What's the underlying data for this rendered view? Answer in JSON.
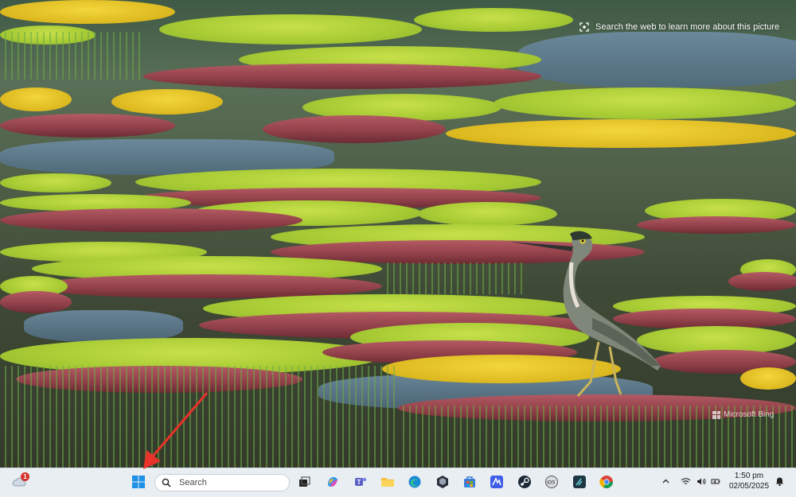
{
  "desktop": {
    "lens_hint": "Search the web to learn more about this picture",
    "watermark": "Microsoft Bing"
  },
  "taskbar": {
    "weather_badge": "1",
    "search_placeholder": "Search",
    "pinned": [
      {
        "name": "task-view"
      },
      {
        "name": "copilot"
      },
      {
        "name": "teams"
      },
      {
        "name": "file-explorer"
      },
      {
        "name": "edge"
      },
      {
        "name": "dark-app"
      },
      {
        "name": "store"
      },
      {
        "name": "blue-app"
      },
      {
        "name": "steam"
      },
      {
        "name": "ios-app"
      },
      {
        "name": "dark-app-2"
      },
      {
        "name": "chrome"
      }
    ],
    "clock": {
      "time": "1:50 pm",
      "date": "02/05/2025"
    }
  },
  "colors": {
    "taskbar_bg": "#e9eef2",
    "arrow": "#e8322a",
    "windows_blue": "#1e90e6"
  }
}
